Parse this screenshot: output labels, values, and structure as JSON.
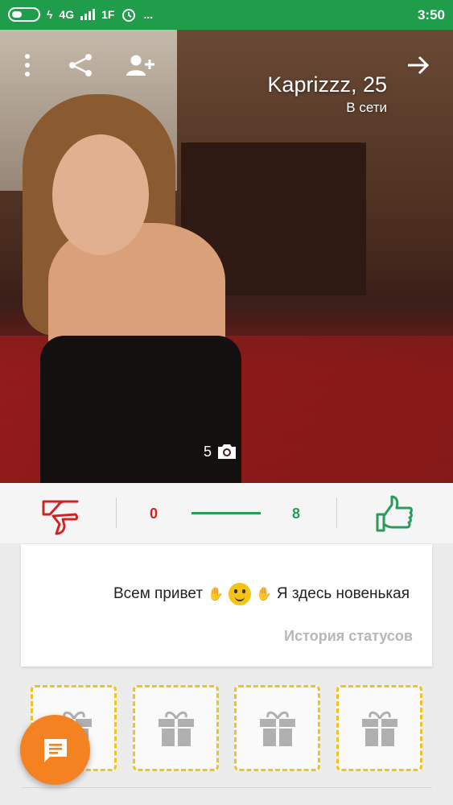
{
  "status_bar": {
    "network": "4G",
    "signal_label": "1F",
    "time": "3:50",
    "dots": "..."
  },
  "profile": {
    "name_age": "Kaprizzz, 25",
    "online_status": "В сети",
    "photo_count": "5"
  },
  "icons": {
    "forward": "arrow-right-icon",
    "add_friend": "add-user-icon",
    "share": "share-icon",
    "menu": "more-vertical-icon",
    "camera": "camera-icon",
    "thumb_up": "thumb-up-icon",
    "thumb_down": "thumb-down-icon",
    "gift": "gift-icon",
    "chat": "chat-icon"
  },
  "rating": {
    "likes": "8",
    "dislikes": "0",
    "like_fraction": 1.0
  },
  "status_card": {
    "text_before": "Всем привет",
    "text_after": "Я здесь новенькая",
    "history_link": "История статусов"
  },
  "gifts": {
    "count": 4
  },
  "colors": {
    "status_bar": "#1f9d4a",
    "like": "#2a9a5a",
    "dislike": "#d02424",
    "gift_border": "#f0c22a",
    "fab": "#f58220",
    "history_link": "#b7b7b7"
  }
}
